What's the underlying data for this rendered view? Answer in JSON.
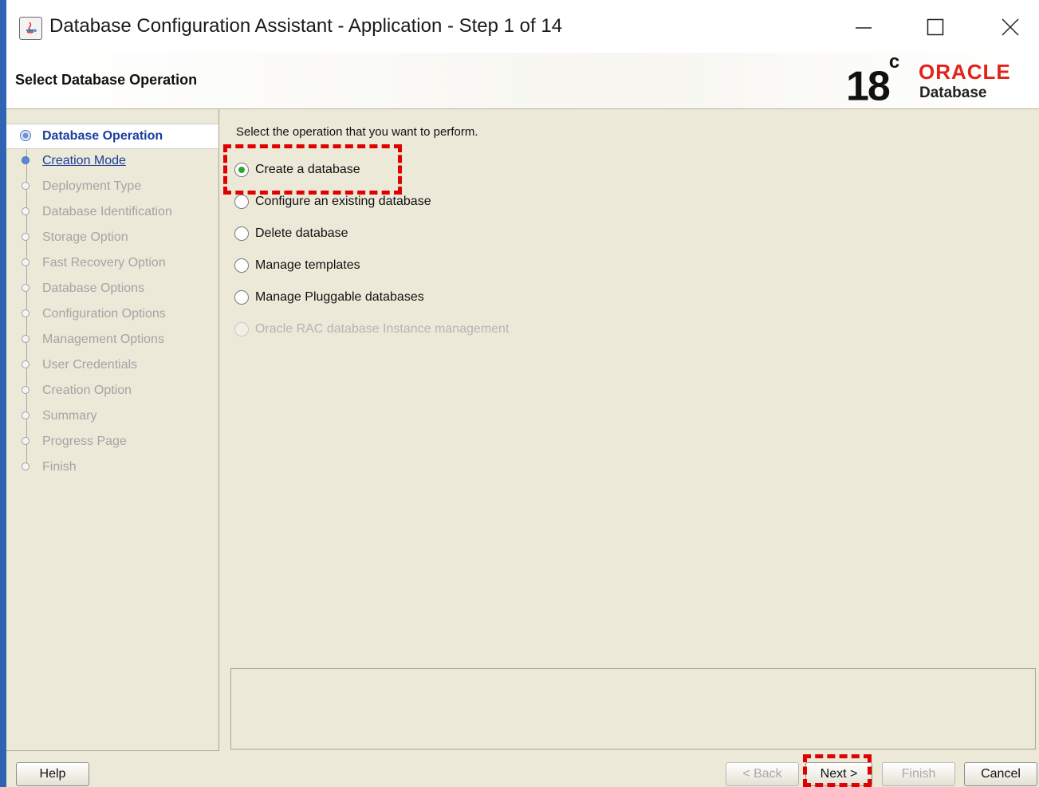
{
  "window": {
    "title": "Database Configuration Assistant - Application - Step 1 of 14"
  },
  "header": {
    "page_title": "Select Database Operation",
    "logo": {
      "version": "18",
      "version_sup": "c",
      "brand": "ORACLE",
      "product": "Database",
      "brand_color": "#e2231a"
    }
  },
  "steps": [
    {
      "label": "Database Operation",
      "state": "current"
    },
    {
      "label": "Creation Mode",
      "state": "next"
    },
    {
      "label": "Deployment Type",
      "state": "disabled"
    },
    {
      "label": "Database Identification",
      "state": "disabled"
    },
    {
      "label": "Storage Option",
      "state": "disabled"
    },
    {
      "label": "Fast Recovery Option",
      "state": "disabled"
    },
    {
      "label": "Database Options",
      "state": "disabled"
    },
    {
      "label": "Configuration Options",
      "state": "disabled"
    },
    {
      "label": "Management Options",
      "state": "disabled"
    },
    {
      "label": "User Credentials",
      "state": "disabled"
    },
    {
      "label": "Creation Option",
      "state": "disabled"
    },
    {
      "label": "Summary",
      "state": "disabled"
    },
    {
      "label": "Progress Page",
      "state": "disabled"
    },
    {
      "label": "Finish",
      "state": "disabled"
    }
  ],
  "content": {
    "prompt": "Select the operation that you want to perform.",
    "options": [
      {
        "label": "Create a database",
        "selected": true,
        "enabled": true
      },
      {
        "label": "Configure an existing database",
        "selected": false,
        "enabled": true
      },
      {
        "label": "Delete database",
        "selected": false,
        "enabled": true
      },
      {
        "label": "Manage templates",
        "selected": false,
        "enabled": true
      },
      {
        "label": "Manage Pluggable databases",
        "selected": false,
        "enabled": true
      },
      {
        "label": "Oracle RAC database Instance management",
        "selected": false,
        "enabled": false
      }
    ]
  },
  "buttons": {
    "help": "Help",
    "back": "< Back",
    "next": "Next >",
    "finish": "Finish",
    "cancel": "Cancel"
  },
  "colors": {
    "accent": "#1c3d9c",
    "annotation": "#e00000",
    "selected_radio": "#33a133"
  }
}
